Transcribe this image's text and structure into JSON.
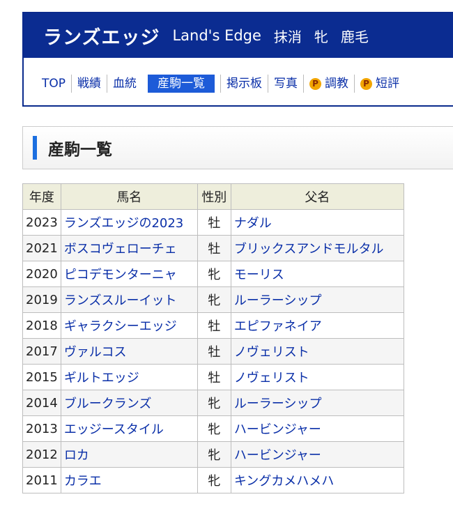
{
  "header": {
    "horse_name": "ランズエッジ",
    "english_name": "Land's Edge",
    "status": "抹消",
    "sex": "牝",
    "coat": "鹿毛"
  },
  "nav": {
    "items": [
      "TOP",
      "戦績",
      "血統",
      "産駒一覧",
      "掲示板",
      "写真",
      "調教",
      "短評"
    ],
    "active": "産駒一覧",
    "premium_badge": "P"
  },
  "section": {
    "title": "産駒一覧"
  },
  "table": {
    "headers": [
      "年度",
      "馬名",
      "性別",
      "父名"
    ],
    "rows": [
      {
        "year": "2023",
        "name": "ランズエッジの2023",
        "sex": "牡",
        "sire": "ナダル"
      },
      {
        "year": "2021",
        "name": "ボスコヴェローチェ",
        "sex": "牡",
        "sire": "ブリックスアンドモルタル"
      },
      {
        "year": "2020",
        "name": "ピコデモンターニャ",
        "sex": "牝",
        "sire": "モーリス"
      },
      {
        "year": "2019",
        "name": "ランズスルーイット",
        "sex": "牝",
        "sire": "ルーラーシップ"
      },
      {
        "year": "2018",
        "name": "ギャラクシーエッジ",
        "sex": "牡",
        "sire": "エピファネイア"
      },
      {
        "year": "2017",
        "name": "ヴァルコス",
        "sex": "牡",
        "sire": "ノヴェリスト"
      },
      {
        "year": "2015",
        "name": "ギルトエッジ",
        "sex": "牡",
        "sire": "ノヴェリスト"
      },
      {
        "year": "2014",
        "name": "ブルークランズ",
        "sex": "牝",
        "sire": "ルーラーシップ"
      },
      {
        "year": "2013",
        "name": "エッジースタイル",
        "sex": "牝",
        "sire": "ハービンジャー"
      },
      {
        "year": "2012",
        "name": "ロカ",
        "sex": "牝",
        "sire": "ハービンジャー"
      },
      {
        "year": "2011",
        "name": "カラエ",
        "sex": "牝",
        "sire": "キングカメハメハ"
      }
    ]
  },
  "colors": {
    "header_bg": "#0b2c91",
    "link": "#0a2fa8",
    "active_tab": "#1d5bd8",
    "table_head_bg": "#eeeedc"
  }
}
